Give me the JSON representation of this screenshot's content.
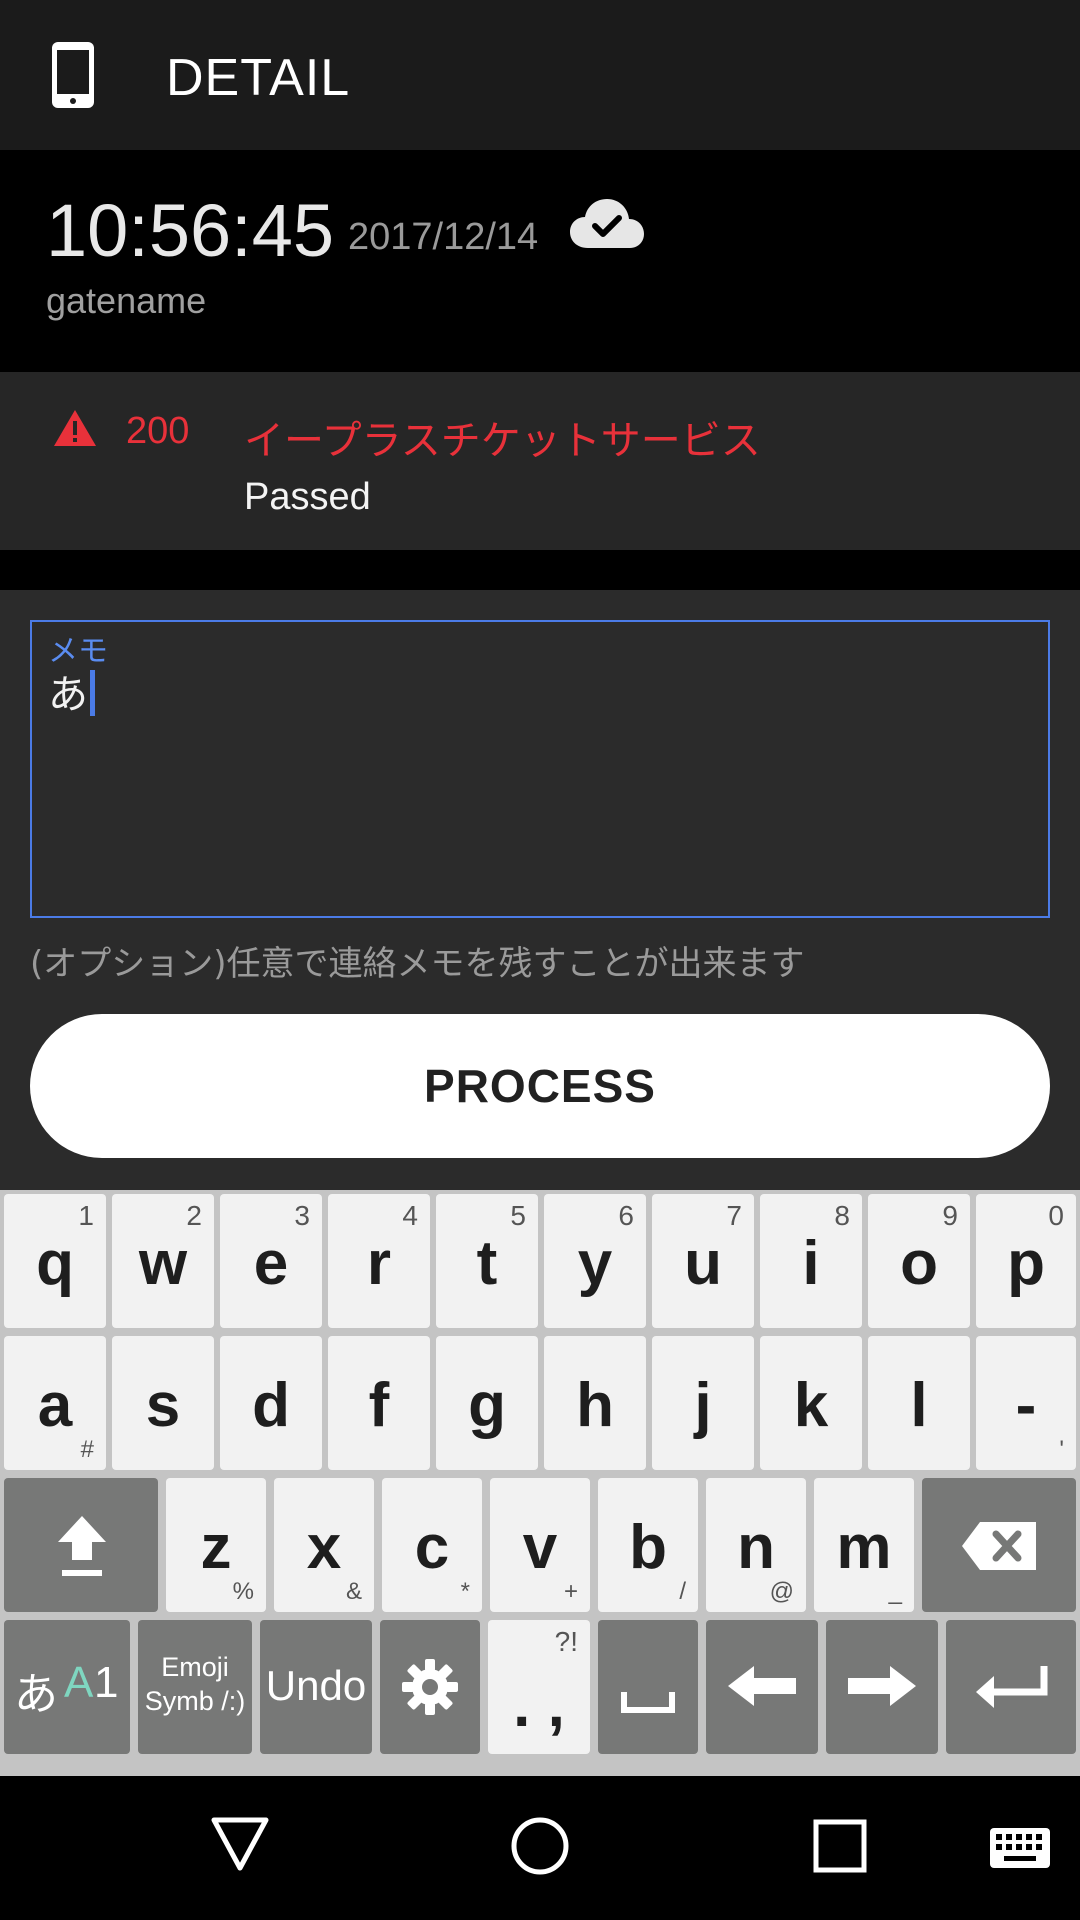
{
  "app_bar": {
    "title": "DETAIL",
    "icon": "phone-icon"
  },
  "record": {
    "time": "10:56:45",
    "date": "2017/12/14",
    "sync_icon": "cloud-check-icon",
    "gate": "gatename"
  },
  "status": {
    "icon": "warning-icon",
    "code": "200",
    "service": "イープラスチケットサービス",
    "result": "Passed",
    "color": "#e8313a"
  },
  "memo": {
    "label": "メモ",
    "value": "あ",
    "hint": "(オプション)任意で連絡メモを残すことが出来ます",
    "accent": "#4b7be6"
  },
  "actions": {
    "process_label": "PROCESS"
  },
  "keyboard": {
    "row1": [
      {
        "key": "q",
        "sup": "1"
      },
      {
        "key": "w",
        "sup": "2"
      },
      {
        "key": "e",
        "sup": "3"
      },
      {
        "key": "r",
        "sup": "4"
      },
      {
        "key": "t",
        "sup": "5"
      },
      {
        "key": "y",
        "sup": "6"
      },
      {
        "key": "u",
        "sup": "7"
      },
      {
        "key": "i",
        "sup": "8"
      },
      {
        "key": "o",
        "sup": "9"
      },
      {
        "key": "p",
        "sup": "0"
      }
    ],
    "row2": [
      {
        "key": "a",
        "sub": "#"
      },
      {
        "key": "s"
      },
      {
        "key": "d"
      },
      {
        "key": "f"
      },
      {
        "key": "g"
      },
      {
        "key": "h"
      },
      {
        "key": "j"
      },
      {
        "key": "k"
      },
      {
        "key": "l"
      },
      {
        "key": "-",
        "sub": "'"
      }
    ],
    "row3": [
      {
        "key": "z",
        "sub": "%"
      },
      {
        "key": "x",
        "sub": "&"
      },
      {
        "key": "c",
        "sub": "*"
      },
      {
        "key": "v",
        "sub": "+"
      },
      {
        "key": "b",
        "sub": "/"
      },
      {
        "key": "n",
        "sub": "@"
      },
      {
        "key": "m",
        "sub": "_"
      }
    ],
    "mode_key": {
      "a": "あ",
      "b": "A",
      "c": "1"
    },
    "emoji_key": {
      "line1": "Emoji",
      "line2": "Symb /:)"
    },
    "undo_label": "Undo",
    "punct_key": {
      "main": ". ,",
      "sup": "?!"
    }
  },
  "nav": [
    "back-icon",
    "home-icon",
    "recents-icon",
    "keyboard-switch-icon"
  ]
}
